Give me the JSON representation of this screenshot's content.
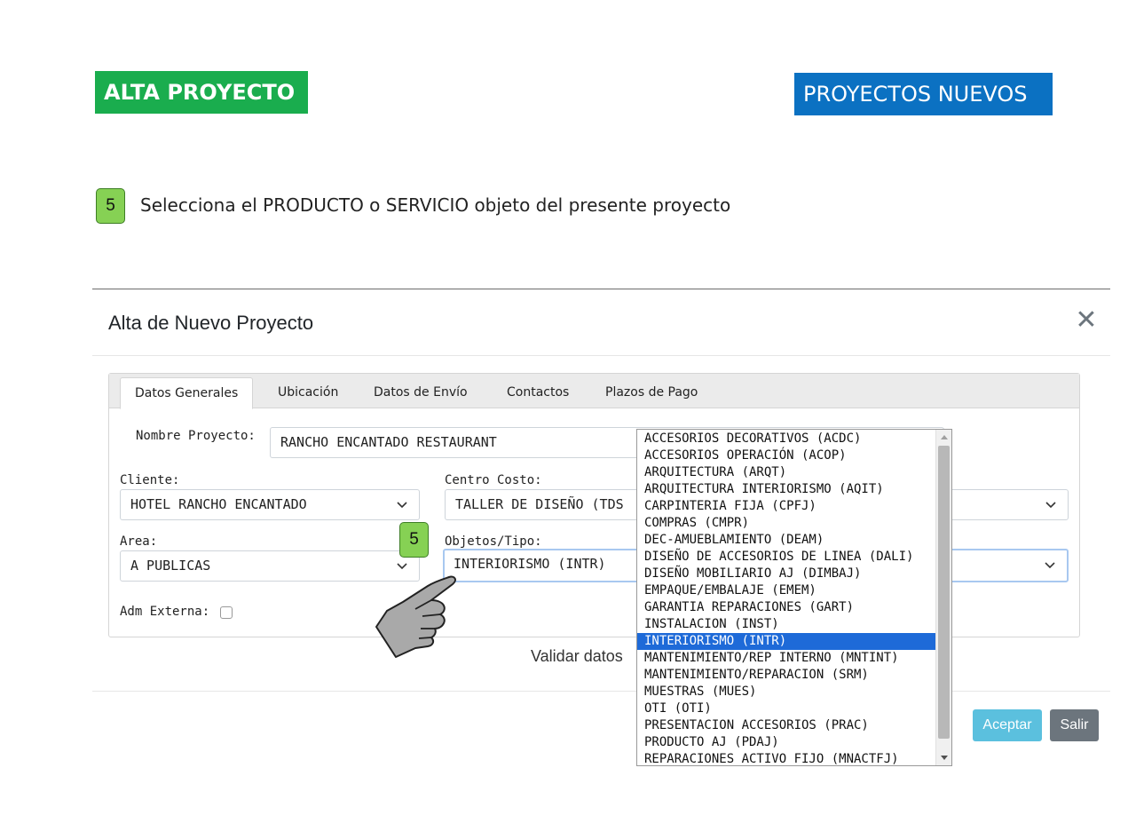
{
  "slide": {
    "title_left": "ALTA PROYECTO",
    "title_right": "PROYECTOS NUEVOS",
    "step_number": "5",
    "instruction": "Selecciona el PRODUCTO  o SERVICIO objeto del presente proyecto",
    "callout_number": "5"
  },
  "modal": {
    "title": "Alta de Nuevo Proyecto",
    "close_glyph": "✕",
    "tabs": [
      {
        "label": "Datos Generales",
        "active": true
      },
      {
        "label": "Ubicación"
      },
      {
        "label": "Datos de Envío"
      },
      {
        "label": "Contactos"
      },
      {
        "label": "Plazos de Pago"
      }
    ],
    "form": {
      "nombre_label": "Nombre Proyecto:",
      "nombre_value": "RANCHO ENCANTADO RESTAURANT",
      "cliente_label": "Cliente:",
      "cliente_value": "HOTEL RANCHO ENCANTADO",
      "centro_label": "Centro Costo:",
      "centro_value": "TALLER DE DISEÑO (TDS",
      "area_label": "Area:",
      "area_value": "A PUBLICAS",
      "objetos_label": "Objetos/Tipo:",
      "objetos_value": "INTERIORISMO (INTR)",
      "adm_label": "Adm Externa:",
      "adm_checked": false
    },
    "validar_label": "Validar datos",
    "buttons": {
      "aceptar": "Aceptar",
      "salir": "Salir"
    }
  },
  "dropdown": {
    "selected": "INTERIORISMO (INTR)",
    "options": [
      "ACCESORIOS DECORATIVOS (ACDC)",
      "ACCESORIOS OPERACIÓN (ACOP)",
      "ARQUITECTURA (ARQT)",
      "ARQUITECTURA INTERIORISMO (AQIT)",
      "CARPINTERIA FIJA (CPFJ)",
      "COMPRAS (CMPR)",
      "DEC-AMUEBLAMIENTO (DEAM)",
      "DISEÑO DE ACCESORIOS DE LINEA (DALI)",
      "DISEÑO MOBILIARIO AJ (DIMBAJ)",
      "EMPAQUE/EMBALAJE (EMEM)",
      "GARANTIA REPARACIONES (GART)",
      "INSTALACION (INST)",
      "INTERIORISMO (INTR)",
      "MANTENIMIENTO/REP INTERNO (MNTINT)",
      "MANTENIMIENTO/REPARACION (SRM)",
      "MUESTRAS (MUES)",
      "OTI (OTI)",
      "PRESENTACION ACCESORIOS (PRAC)",
      "PRODUCTO AJ (PDAJ)",
      "REPARACIONES ACTIVO FIJO (MNACTFJ)"
    ]
  },
  "colors": {
    "green_badge": "#1aad4e",
    "blue_badge": "#0b71c2",
    "step_badge": "#86d154",
    "selected_option": "#1e6ad8",
    "aceptar": "#5bc0de",
    "salir": "#6c757d"
  },
  "icons": {
    "pointer": "pointing-hand-icon",
    "chevron": "chevron-down-icon",
    "close": "close-icon"
  }
}
